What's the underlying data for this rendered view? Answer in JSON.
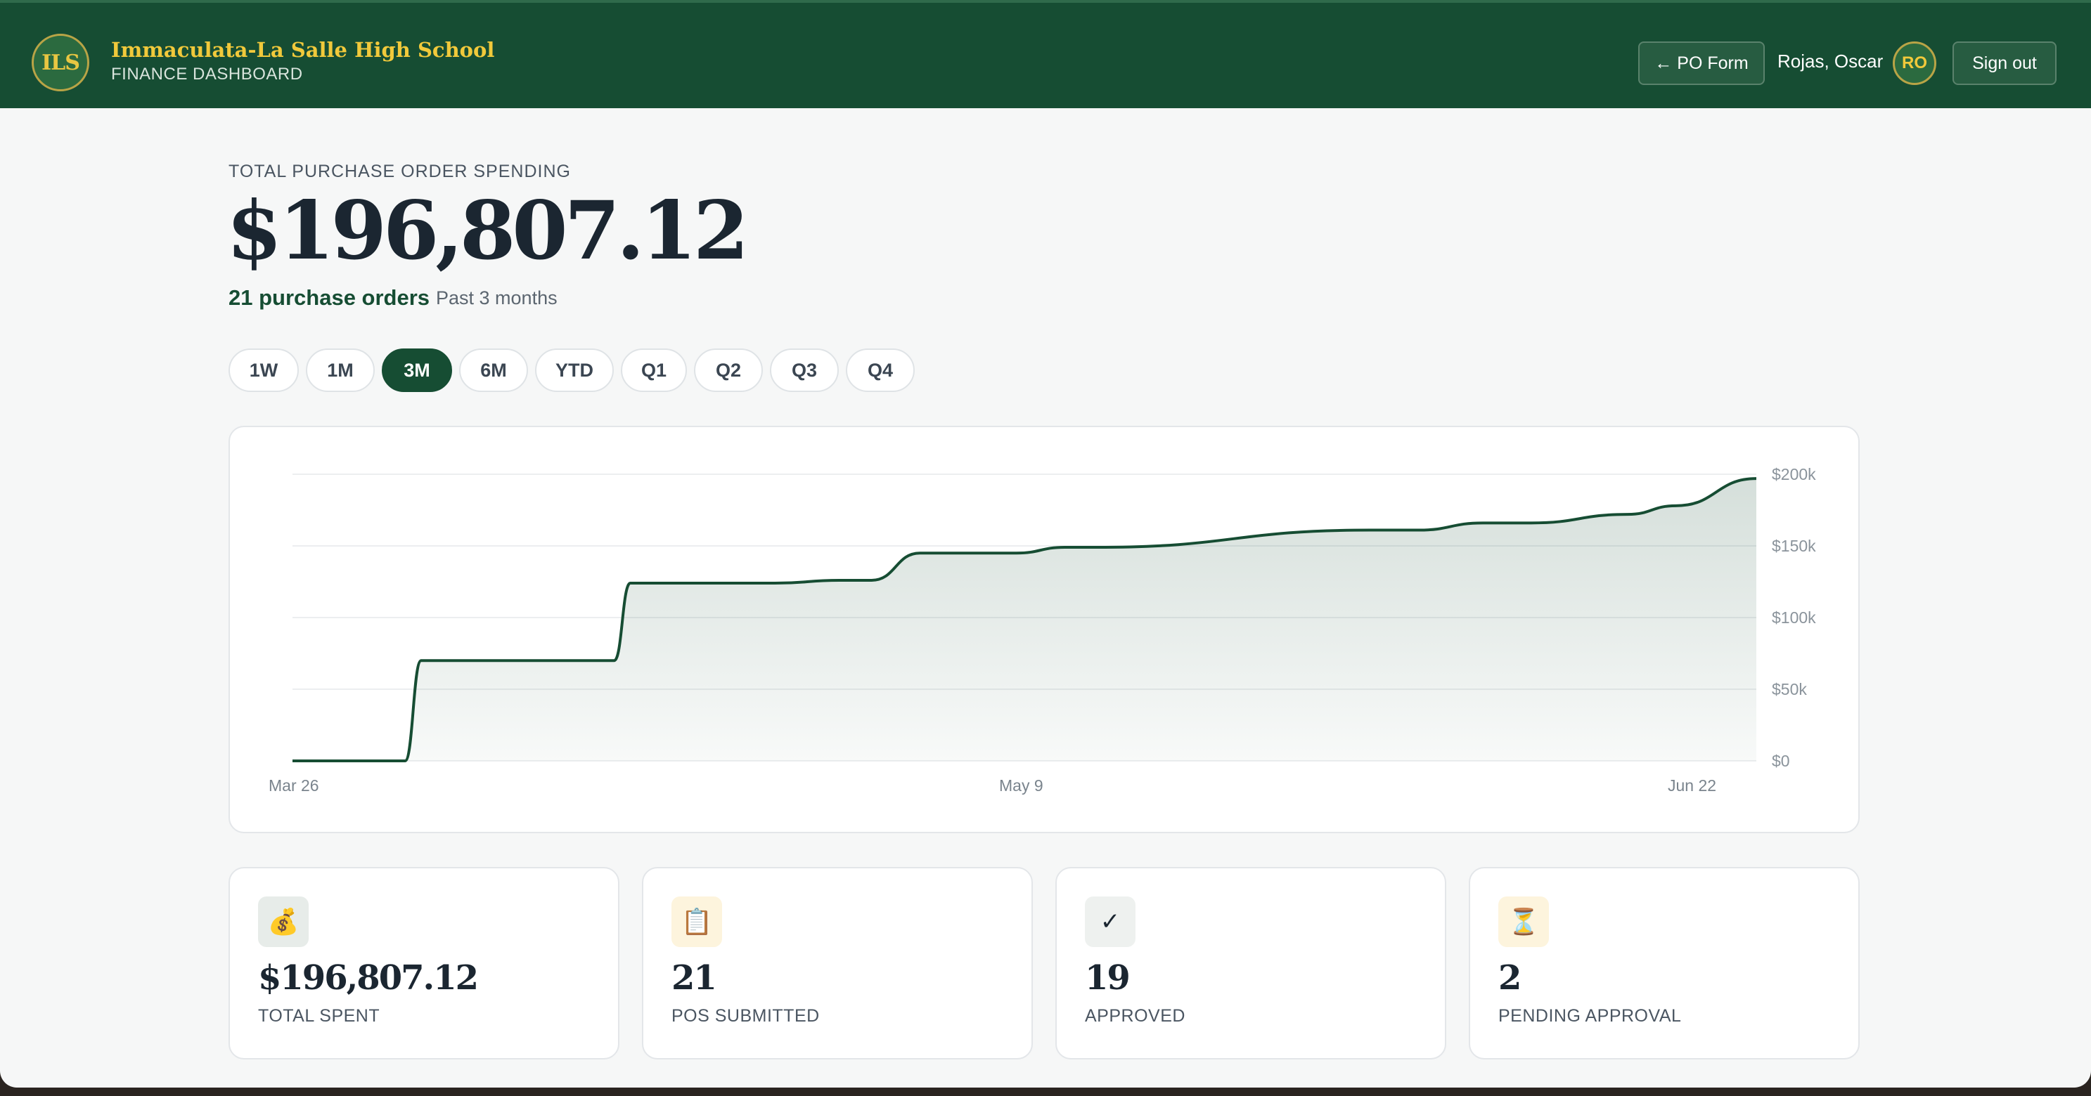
{
  "header": {
    "logo_text": "ILS",
    "school_name": "Immaculata-La Salle High School",
    "subtitle": "FINANCE DASHBOARD",
    "po_form_label": "← PO Form",
    "user_name": "Rojas, Oscar",
    "avatar_initials": "RO",
    "sign_out_label": "Sign out"
  },
  "summary": {
    "kicker": "TOTAL PURCHASE ORDER SPENDING",
    "total": "$196,807.12",
    "po_count": "21 purchase orders",
    "period": "Past 3 months"
  },
  "ranges": [
    {
      "label": "1W",
      "active": false
    },
    {
      "label": "1M",
      "active": false
    },
    {
      "label": "3M",
      "active": true
    },
    {
      "label": "6M",
      "active": false
    },
    {
      "label": "YTD",
      "active": false
    },
    {
      "label": "Q1",
      "active": false
    },
    {
      "label": "Q2",
      "active": false
    },
    {
      "label": "Q3",
      "active": false
    },
    {
      "label": "Q4",
      "active": false
    }
  ],
  "chart_data": {
    "type": "area",
    "x": [
      "2025-03-26",
      "2025-04-02",
      "2025-04-03",
      "2025-04-15",
      "2025-04-16",
      "2025-04-25",
      "2025-04-29",
      "2025-05-01",
      "2025-05-04",
      "2025-05-10",
      "2025-05-13",
      "2025-05-15",
      "2025-06-01",
      "2025-06-04",
      "2025-06-08",
      "2025-06-11",
      "2025-06-17",
      "2025-06-20",
      "2025-06-25"
    ],
    "values": [
      0,
      0,
      70000,
      70000,
      124000,
      124000,
      126000,
      126000,
      145000,
      145000,
      149000,
      149000,
      161000,
      161000,
      166000,
      166000,
      172000,
      178000,
      197000
    ],
    "x_tick_labels": [
      "Mar 26",
      "May 9",
      "Jun 22"
    ],
    "y_tick_labels": [
      "$0",
      "$50k",
      "$100k",
      "$150k",
      "$200k"
    ],
    "ylim": [
      0,
      200000
    ],
    "grid": true,
    "y_axis_side": "right",
    "line_color": "#164d33",
    "fill_color": "#164d33"
  },
  "stats": [
    {
      "icon": "money-bag-icon",
      "glyph": "💰",
      "value": "$196,807.12",
      "label": "TOTAL SPENT",
      "bg": "#e7ece9"
    },
    {
      "icon": "clipboard-icon",
      "glyph": "📋",
      "value": "21",
      "label": "POS SUBMITTED",
      "bg": "#fdf4dd"
    },
    {
      "icon": "check-icon",
      "glyph": "✓",
      "value": "19",
      "label": "APPROVED",
      "bg": "#eef1ef"
    },
    {
      "icon": "hourglass-icon",
      "glyph": "⏳",
      "value": "2",
      "label": "PENDING APPROVAL",
      "bg": "#fdf4dd"
    }
  ]
}
